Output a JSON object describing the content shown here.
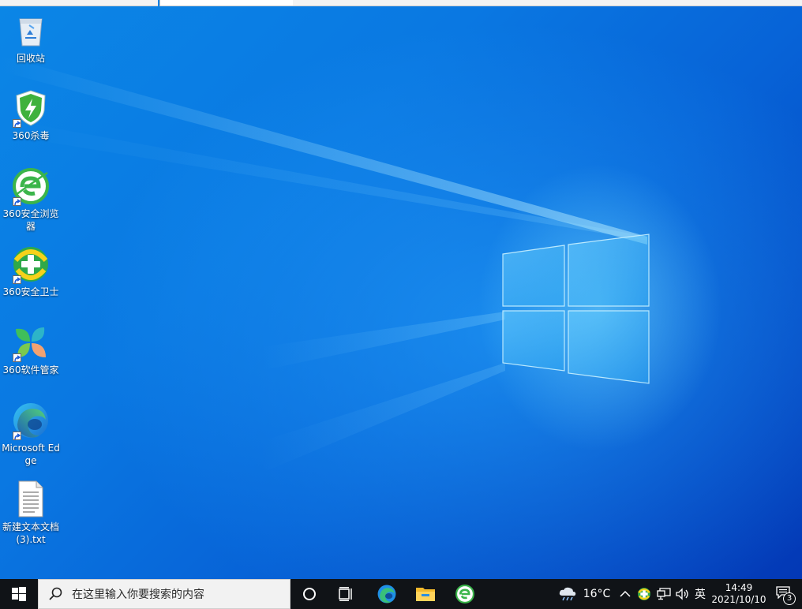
{
  "desktop": {
    "icons": [
      {
        "label": "回收站",
        "icon": "recycle-bin-icon"
      },
      {
        "label": "360杀毒",
        "icon": "360-antivirus-icon"
      },
      {
        "label": "360安全浏览器",
        "icon": "360-browser-icon"
      },
      {
        "label": "360安全卫士",
        "icon": "360-security-guard-icon"
      },
      {
        "label": "360软件管家",
        "icon": "360-software-manager-icon"
      },
      {
        "label": "Microsoft Edge",
        "icon": "edge-icon"
      },
      {
        "label": "新建文本文档 (3).txt",
        "icon": "text-file-icon"
      }
    ]
  },
  "taskbar": {
    "search_placeholder": "在这里输入你要搜索的内容",
    "pinned": [
      "task-view-icon",
      "edge-icon",
      "file-explorer-icon",
      "360-browser-icon"
    ],
    "weather": {
      "temperature": "16°C",
      "icon": "cloud-rain-icon"
    },
    "ime": "英",
    "clock": {
      "time": "14:49",
      "date": "2021/10/10"
    },
    "notification_count": "3"
  },
  "colors": {
    "taskbar_bg": "#101317",
    "desktop_accent": "#0a78e2"
  }
}
